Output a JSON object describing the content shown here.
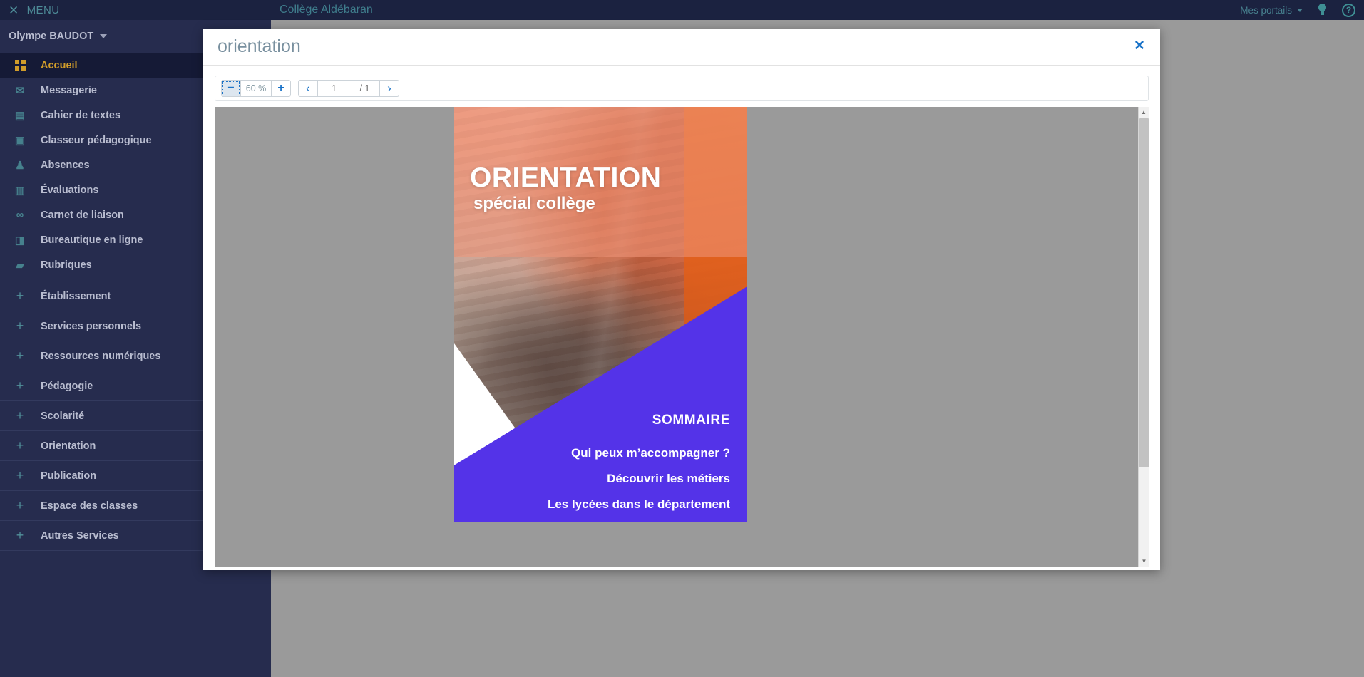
{
  "topbar": {
    "menu_label": "MENU",
    "menu_icon": "close-x-icon",
    "portal_title": "Collège Aldébaran",
    "portals_label": "Mes portails",
    "bulb_icon": "lightbulb-icon",
    "help_icon": "help-question-icon"
  },
  "sidebar": {
    "user_name": "Olympe BAUDOT",
    "nav_items": [
      {
        "label": "Accueil",
        "icon": "grid-icon",
        "active": true
      },
      {
        "label": "Messagerie",
        "icon": "envelope-icon",
        "glyph": "✉",
        "active": false
      },
      {
        "label": "Cahier de textes",
        "icon": "notebook-icon",
        "glyph": "▤",
        "active": false
      },
      {
        "label": "Classeur pédagogique",
        "icon": "binder-icon",
        "glyph": "▣",
        "active": false
      },
      {
        "label": "Absences",
        "icon": "people-icon",
        "glyph": "♟",
        "active": false
      },
      {
        "label": "Évaluations",
        "icon": "bar-chart-icon",
        "glyph": "▥",
        "active": false
      },
      {
        "label": "Carnet de liaison",
        "icon": "link-icon",
        "glyph": "∞",
        "active": false
      },
      {
        "label": "Bureautique en ligne",
        "icon": "office-doc-icon",
        "glyph": "◨",
        "active": false
      },
      {
        "label": "Rubriques",
        "icon": "speech-bubble-icon",
        "glyph": "▰",
        "active": false
      }
    ],
    "accordion_items": [
      {
        "label": "Établissement",
        "icon": "plus-icon"
      },
      {
        "label": "Services personnels",
        "icon": "plus-icon"
      },
      {
        "label": "Ressources numériques",
        "icon": "plus-icon"
      },
      {
        "label": "Pédagogie",
        "icon": "plus-icon"
      },
      {
        "label": "Scolarité",
        "icon": "plus-icon"
      },
      {
        "label": "Orientation",
        "icon": "plus-icon"
      },
      {
        "label": "Publication",
        "icon": "plus-icon"
      },
      {
        "label": "Espace des classes",
        "icon": "plus-icon"
      },
      {
        "label": "Autres Services",
        "icon": "plus-icon"
      }
    ]
  },
  "background": {
    "card_links": [
      "nations",
      "nations",
      "nations"
    ]
  },
  "modal": {
    "title": "orientation",
    "close_icon": "close-x-icon",
    "toolbar": {
      "zoom_out_label": "−",
      "zoom_value": "60 %",
      "zoom_in_label": "+",
      "prev_icon": "chevron-left-icon",
      "page_value": "1",
      "page_total": "/ 1",
      "next_icon": "chevron-right-icon"
    },
    "scrollbar": {
      "up_icon": "triangle-up-icon",
      "down_icon": "triangle-down-icon"
    },
    "document": {
      "title": "ORIENTATION",
      "subtitle": "spécial collège",
      "sommaire_title": "SOMMAIRE",
      "sommaire_items": [
        "Qui peux m’accompagner ?",
        "Découvrir les métiers",
        "Les lycées dans le département"
      ],
      "accent_purple": "#5433e8",
      "accent_orange": "#e4611c"
    }
  }
}
